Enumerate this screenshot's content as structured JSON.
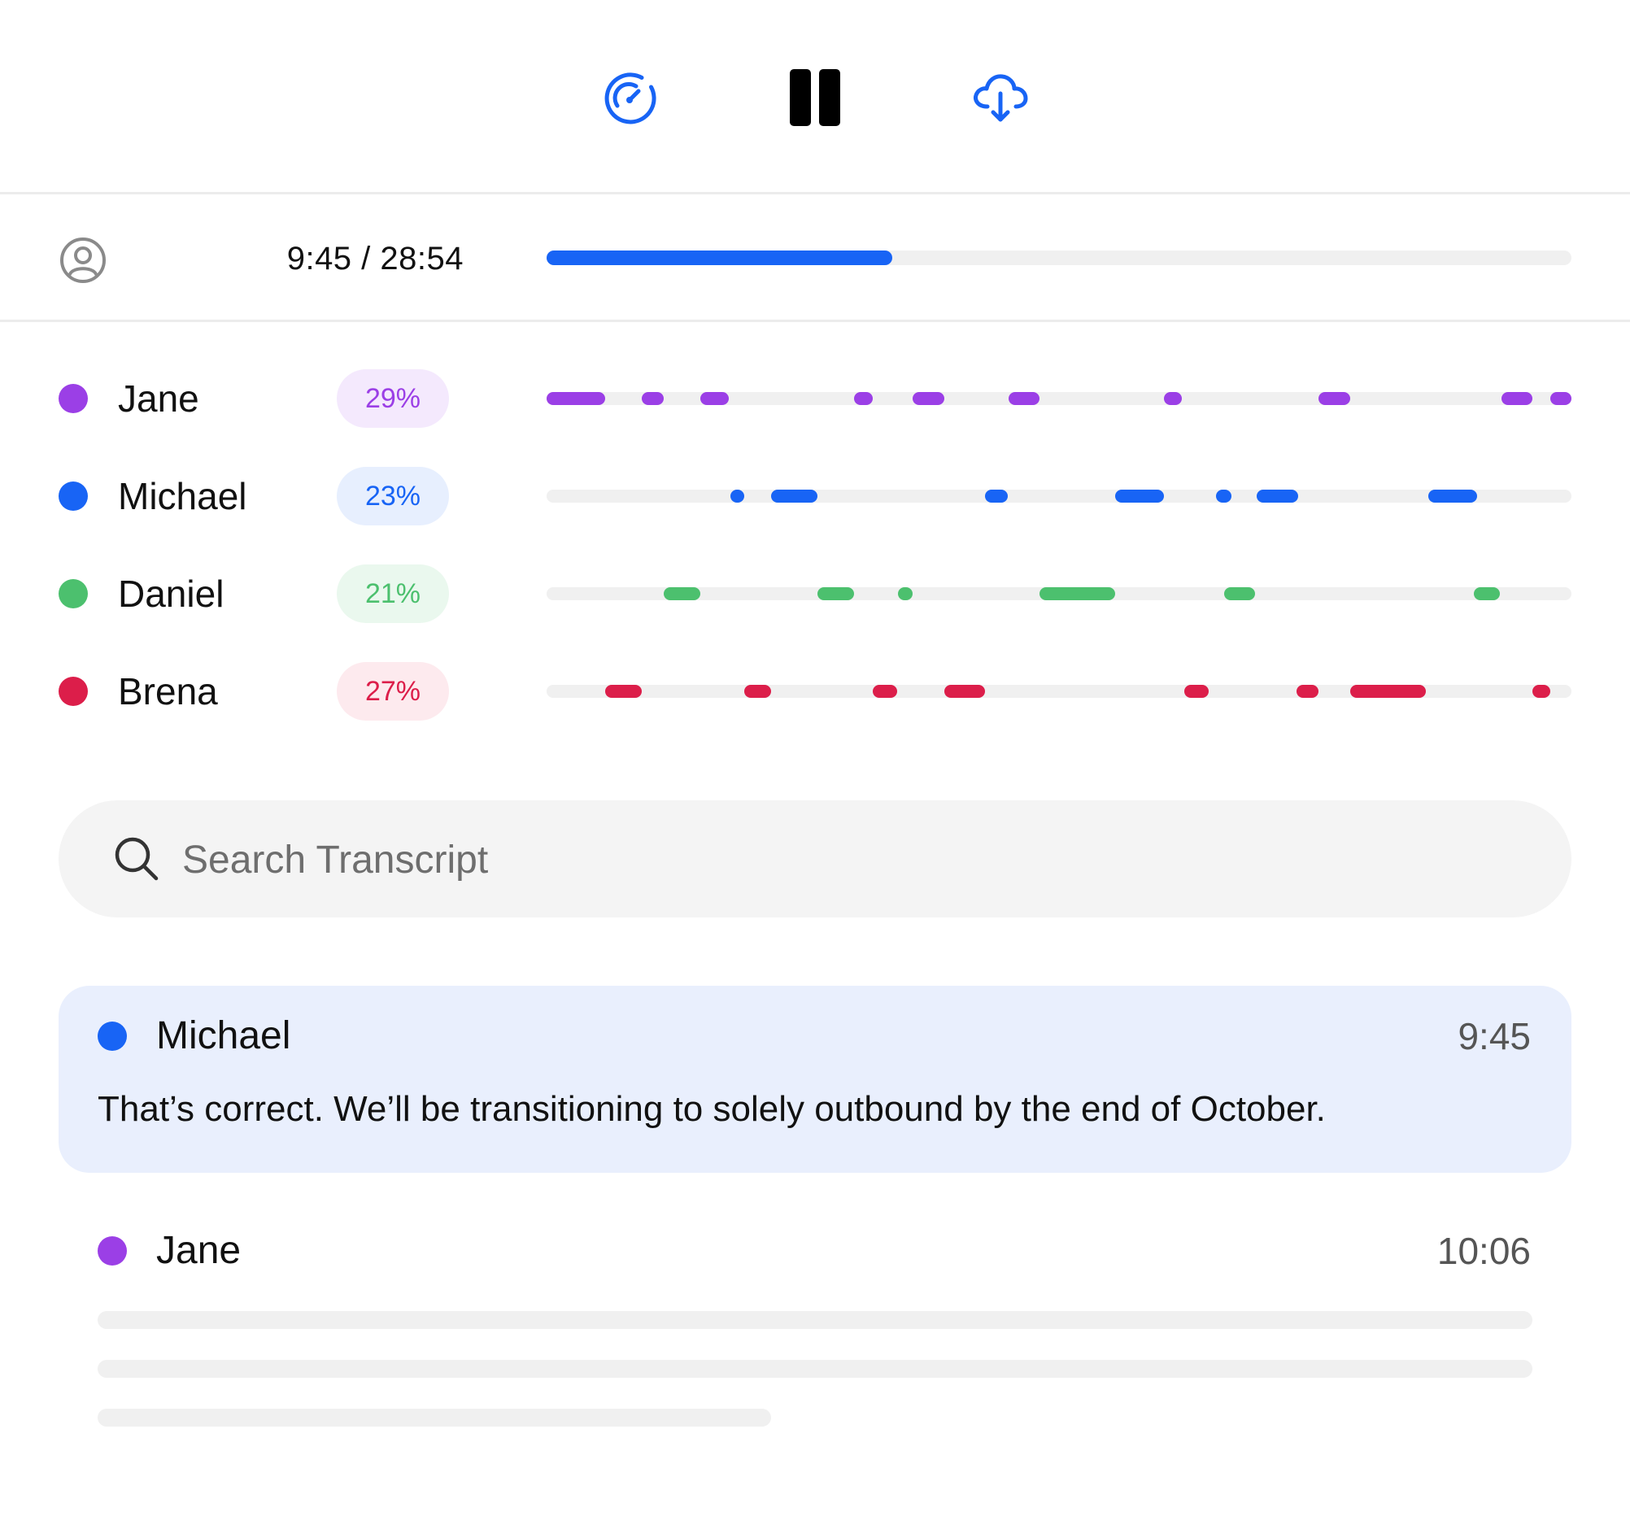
{
  "controls": {
    "speed_icon": "speedometer-icon",
    "pause_icon": "pause-icon",
    "download_icon": "cloud-download-icon"
  },
  "player": {
    "user_icon": "user-circle-icon",
    "time_display": "9:45 / 28:54",
    "progress_fraction": 0.3376,
    "progress_color": "#1864f5"
  },
  "speakers": [
    {
      "name": "Jane",
      "percent": "29%",
      "color": "#9b3fe6",
      "pill_bg": "#f4e9fd",
      "segments": [
        [
          0.0,
          0.057
        ],
        [
          0.093,
          0.114
        ],
        [
          0.15,
          0.178
        ],
        [
          0.3,
          0.318
        ],
        [
          0.357,
          0.388
        ],
        [
          0.451,
          0.481
        ],
        [
          0.602,
          0.62
        ],
        [
          0.753,
          0.784
        ],
        [
          0.932,
          0.962
        ],
        [
          0.979,
          1.0
        ]
      ]
    },
    {
      "name": "Michael",
      "percent": "23%",
      "color": "#1864f5",
      "pill_bg": "#e7effe",
      "segments": [
        [
          0.179,
          0.193
        ],
        [
          0.219,
          0.264
        ],
        [
          0.428,
          0.45
        ],
        [
          0.555,
          0.602
        ],
        [
          0.653,
          0.668
        ],
        [
          0.693,
          0.733
        ],
        [
          0.86,
          0.908
        ]
      ]
    },
    {
      "name": "Daniel",
      "percent": "21%",
      "color": "#4cc06e",
      "pill_bg": "#eaf8ee",
      "segments": [
        [
          0.114,
          0.15
        ],
        [
          0.264,
          0.3
        ],
        [
          0.343,
          0.357
        ],
        [
          0.481,
          0.555
        ],
        [
          0.661,
          0.691
        ],
        [
          0.905,
          0.93
        ]
      ]
    },
    {
      "name": "Brena",
      "percent": "27%",
      "color": "#dc1e4a",
      "pill_bg": "#fdeaee",
      "segments": [
        [
          0.057,
          0.093
        ],
        [
          0.193,
          0.219
        ],
        [
          0.318,
          0.342
        ],
        [
          0.388,
          0.428
        ],
        [
          0.622,
          0.646
        ],
        [
          0.732,
          0.753
        ],
        [
          0.784,
          0.858
        ],
        [
          0.962,
          0.979
        ]
      ]
    }
  ],
  "search": {
    "icon": "search-icon",
    "placeholder": "Search Transcript",
    "value": ""
  },
  "transcript": [
    {
      "speaker": "Michael",
      "color": "#1864f5",
      "time": "9:45",
      "text": "That’s correct. We’ll be transitioning to solely outbound by the end of October.",
      "active": true
    },
    {
      "speaker": "Jane",
      "color": "#9b3fe6",
      "time": "10:06",
      "text": "",
      "active": false
    }
  ]
}
